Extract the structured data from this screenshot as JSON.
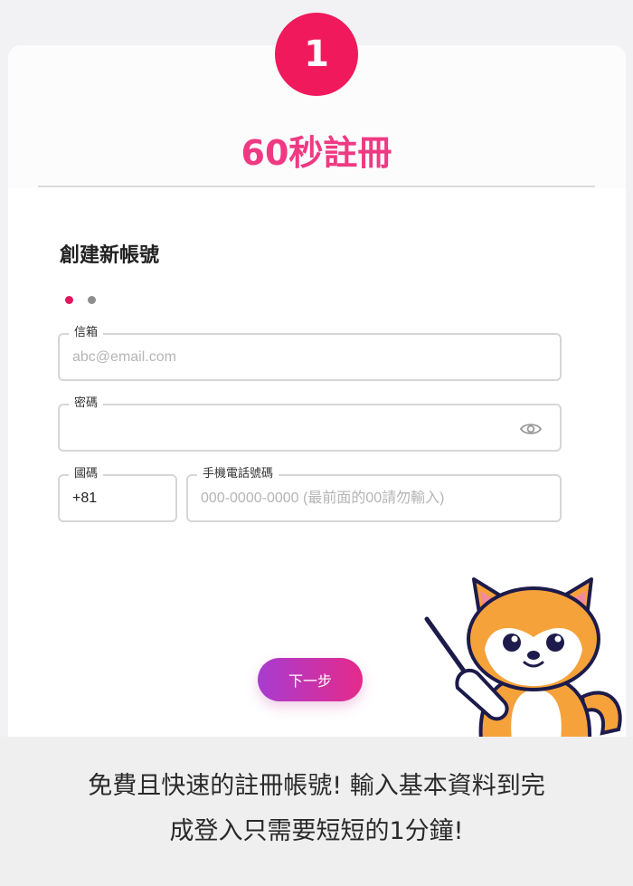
{
  "header": {
    "step_number": "1",
    "title": "60秒註冊"
  },
  "form": {
    "section_title": "創建新帳號",
    "step_dots": {
      "active_color": "#e3155e",
      "inactive_color": "#8e8e8e"
    },
    "email": {
      "label": "信箱",
      "placeholder": "abc@email.com",
      "value": ""
    },
    "password": {
      "label": "密碼",
      "value": "",
      "toggle_icon": "eye-icon"
    },
    "country_code": {
      "label": "國碼",
      "value": "+81"
    },
    "phone": {
      "label": "手機電話號碼",
      "placeholder": "000-0000-0000 (最前面的00請勿輸入)",
      "value": ""
    },
    "next_label": "下一步"
  },
  "mascot": {
    "icon": "shiba-dog-pointer-icon"
  },
  "footer": {
    "line1": "免費且快速的註冊帳號! 輸入基本資料到完",
    "line2": "成登入只需要短短的1分鐘!"
  },
  "colors": {
    "accent": "#f0195c",
    "title": "#ef3a83",
    "button_start": "#a83cd0",
    "button_end": "#e52a8a"
  }
}
